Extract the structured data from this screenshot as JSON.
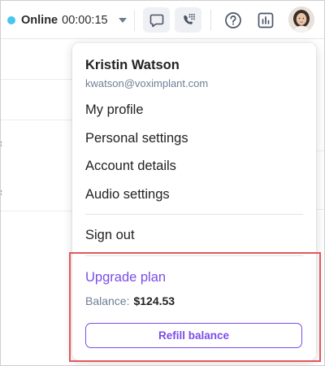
{
  "topbar": {
    "status": {
      "label": "Online",
      "timer": "00:00:15",
      "dot_color": "#49c5ee"
    },
    "icons": [
      "chat-icon",
      "dialpad-phone-icon",
      "help-icon",
      "report-chart-icon",
      "user-avatar"
    ]
  },
  "menu": {
    "user": {
      "name": "Kristin Watson",
      "email": "kwatson@voximplant.com"
    },
    "items": [
      {
        "label": "My profile"
      },
      {
        "label": "Personal settings"
      },
      {
        "label": "Account details"
      },
      {
        "label": "Audio settings"
      }
    ],
    "sign_out": "Sign out",
    "billing": {
      "upgrade_label": "Upgrade plan",
      "balance_label": "Balance:",
      "balance_value": "$124.53",
      "refill_label": "Refill balance"
    }
  },
  "colors": {
    "accent": "#7b4ce8",
    "highlight": "#e2585c",
    "muted_text": "#6e7f95"
  }
}
